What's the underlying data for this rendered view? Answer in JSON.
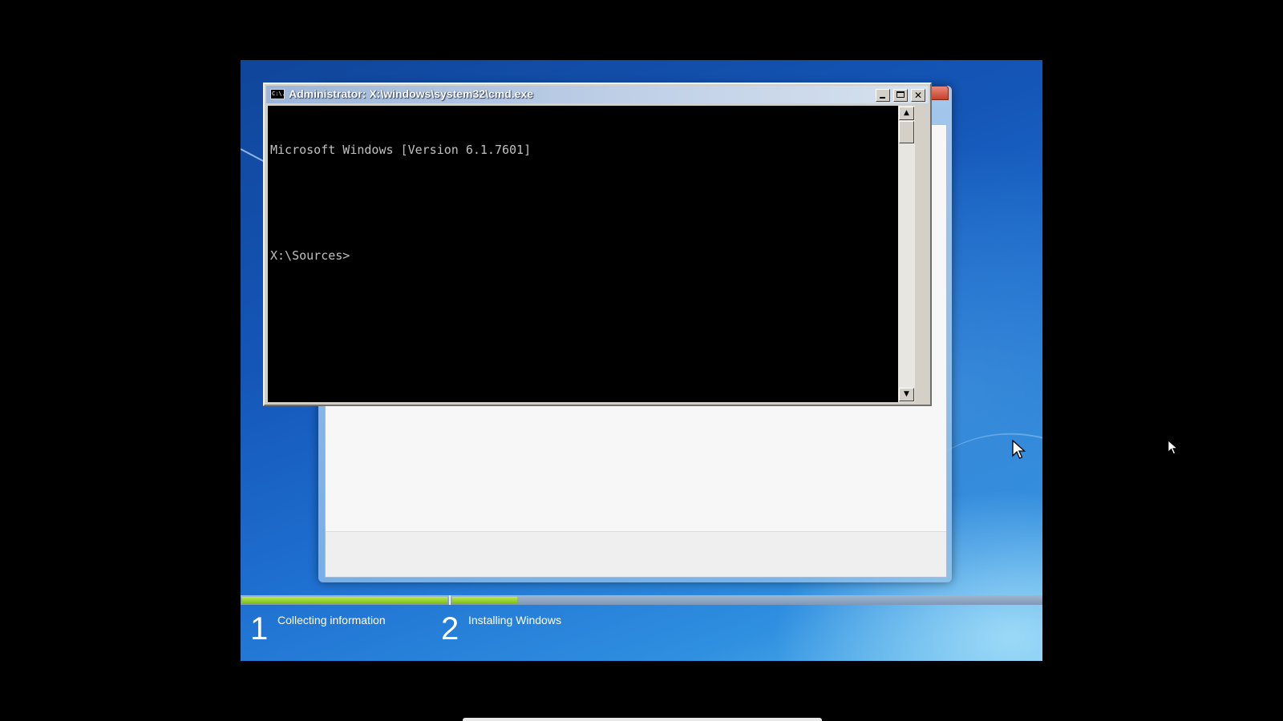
{
  "cmd_window": {
    "title": "Administrator: X:\\windows\\system32\\cmd.exe",
    "icon": "cmd-icon",
    "icon_text": "C:\\.",
    "controls": {
      "minimize": "minimize-icon",
      "maximize": "maximize-icon",
      "close": "close-icon"
    },
    "console_lines": [
      "Microsoft Windows [Version 6.1.7601]",
      "",
      "X:\\Sources>"
    ],
    "scrollbar": {
      "up": "scroll-up-arrow-icon",
      "down": "scroll-down-arrow-icon",
      "up_glyph": "▲",
      "down_glyph": "▼"
    }
  },
  "setup": {
    "progress": {
      "step1_fraction": 1.0,
      "step2_fraction": 0.11
    },
    "steps": [
      {
        "number": "1",
        "label": "Collecting information"
      },
      {
        "number": "2",
        "label": "Installing Windows"
      }
    ],
    "colors": {
      "progress_fill": "#8fd02a",
      "background": "#1e6fd0"
    }
  },
  "cursors": [
    "mouse-pointer-icon",
    "mouse-pointer-icon"
  ]
}
